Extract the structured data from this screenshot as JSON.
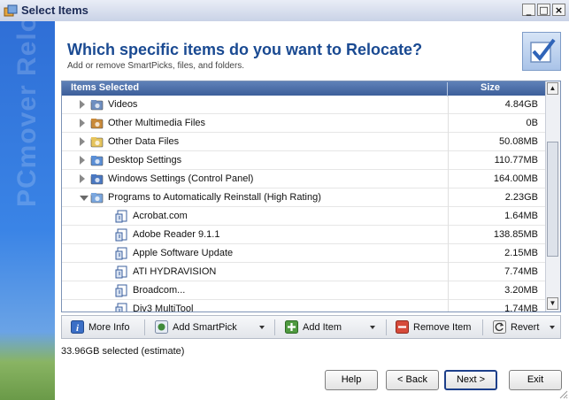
{
  "window": {
    "title": "Select Items",
    "buttons": [
      "_",
      "□",
      "×"
    ]
  },
  "sidebar": {
    "brand": "PCmover Relocator"
  },
  "header": {
    "title": "Which specific items do you want to Relocate?",
    "subtitle": "Add or remove SmartPicks, files, and folders."
  },
  "table": {
    "columns": {
      "name": "Items Selected",
      "size": "Size"
    },
    "rows": [
      {
        "label": "Videos",
        "size": "4.84GB",
        "level": 0,
        "expander": "closed",
        "icon": "video-folder-icon"
      },
      {
        "label": "Other Multimedia Files",
        "size": "0B",
        "level": 0,
        "expander": "closed",
        "icon": "multimedia-icon"
      },
      {
        "label": "Other Data Files",
        "size": "50.08MB",
        "level": 0,
        "expander": "closed",
        "icon": "data-folder-icon"
      },
      {
        "label": "Desktop Settings",
        "size": "110.77MB",
        "level": 0,
        "expander": "closed",
        "icon": "desktop-settings-icon"
      },
      {
        "label": "Windows Settings (Control Panel)",
        "size": "164.00MB",
        "level": 0,
        "expander": "closed",
        "icon": "control-panel-icon"
      },
      {
        "label": "Programs to Automatically Reinstall (High Rating)",
        "size": "2.23GB",
        "level": 0,
        "expander": "open",
        "icon": "programs-icon"
      },
      {
        "label": "Acrobat.com",
        "size": "1.64MB",
        "level": 1,
        "expander": "none",
        "icon": "program-icon"
      },
      {
        "label": "Adobe Reader 9.1.1",
        "size": "138.85MB",
        "level": 1,
        "expander": "none",
        "icon": "program-icon"
      },
      {
        "label": "Apple Software Update",
        "size": "2.15MB",
        "level": 1,
        "expander": "none",
        "icon": "program-icon"
      },
      {
        "label": "ATI HYDRAVISION",
        "size": "7.74MB",
        "level": 1,
        "expander": "none",
        "icon": "program-icon"
      },
      {
        "label": "Broadcom...",
        "size": "3.20MB",
        "level": 1,
        "expander": "none",
        "icon": "program-icon"
      },
      {
        "label": "Div3 MultiTool",
        "size": "1.74MB",
        "level": 1,
        "expander": "none",
        "icon": "program-icon"
      }
    ]
  },
  "toolbar": {
    "more_info": "More Info",
    "add_smartpick": "Add SmartPick",
    "add_item": "Add Item",
    "remove_item": "Remove Item",
    "revert": "Revert"
  },
  "status": "33.96GB selected (estimate)",
  "footer": {
    "help": "Help",
    "back": "< Back",
    "next": "Next >",
    "exit": "Exit"
  },
  "colors": {
    "heading": "#1a4a92",
    "column_header": "#4a6ca6",
    "sidebar": "#3a84e6"
  }
}
